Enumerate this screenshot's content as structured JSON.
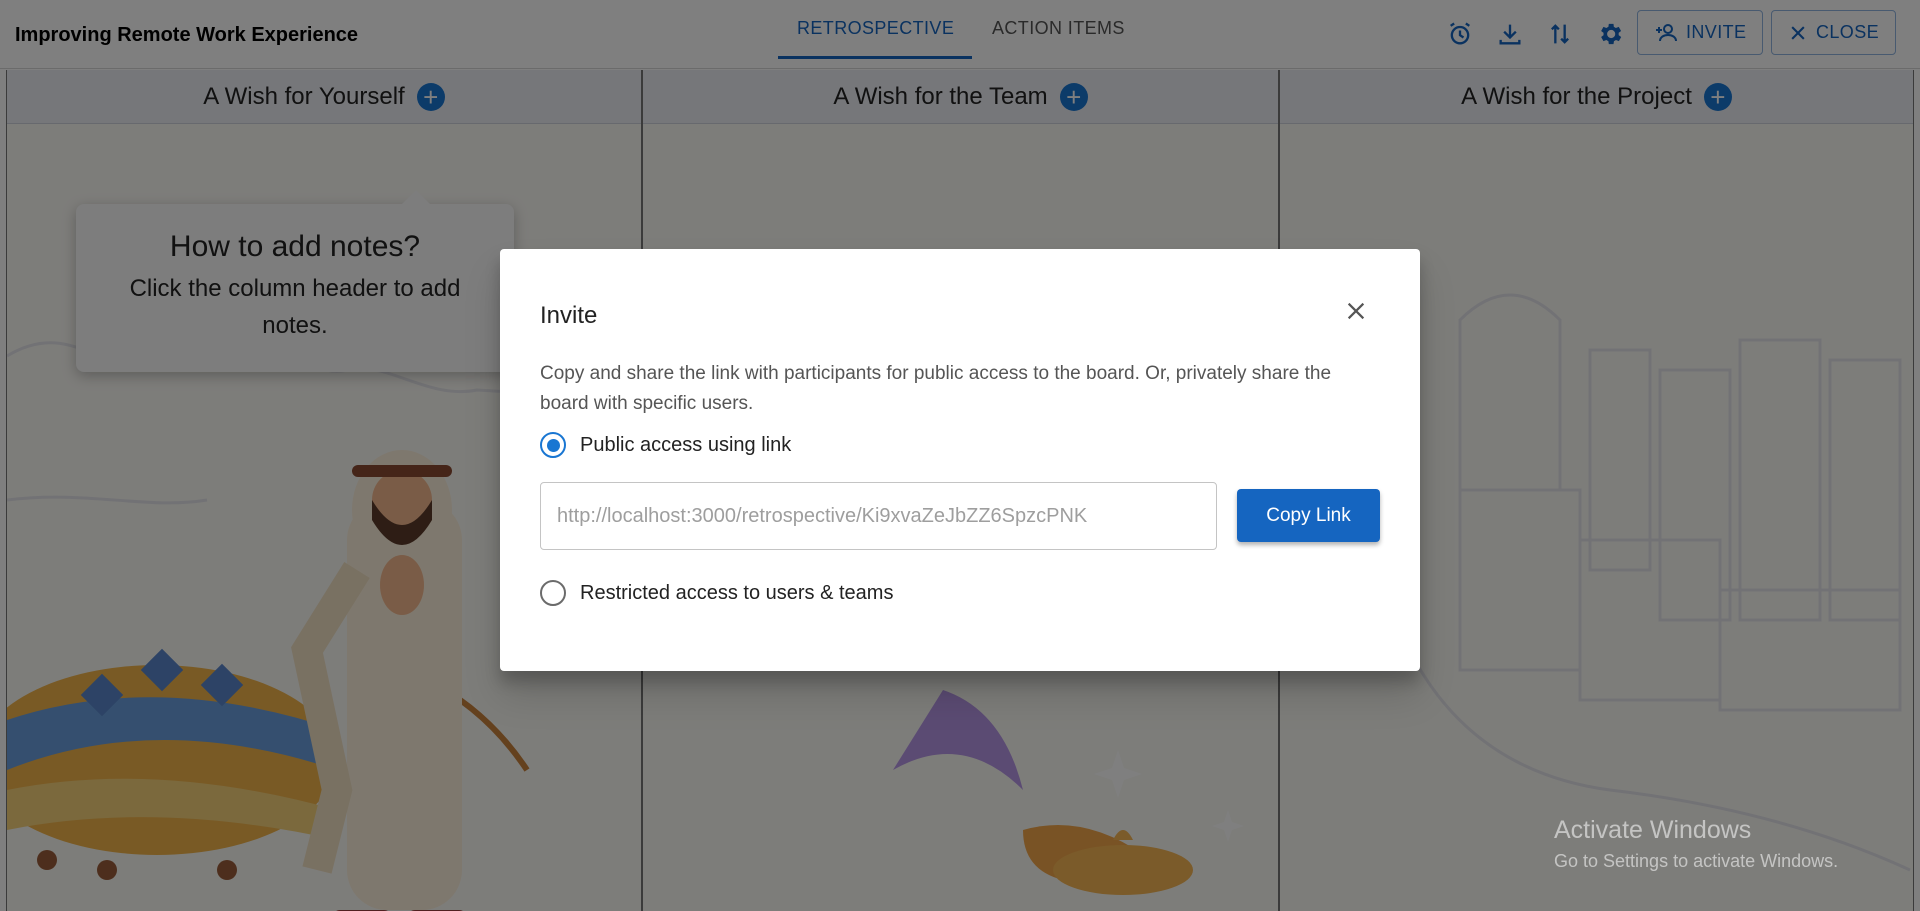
{
  "header": {
    "board_title": "Improving Remote Work Experience",
    "tabs": [
      {
        "label": "RETROSPECTIVE",
        "active": true
      },
      {
        "label": "ACTION ITEMS",
        "active": false
      }
    ],
    "icons": [
      "alarm-icon",
      "download-icon",
      "sort-arrows-icon",
      "gear-icon"
    ],
    "invite_label": "INVITE",
    "close_label": "CLOSE",
    "accent_color": "#1565c0"
  },
  "board": {
    "columns": [
      {
        "title": "A Wish for Yourself"
      },
      {
        "title": "A Wish for the Team"
      },
      {
        "title": "A Wish for the Project"
      }
    ],
    "add_icon": "plus-circle-icon",
    "tooltip": {
      "title": "How to add notes?",
      "body": "Click the column header to add notes."
    }
  },
  "dialog": {
    "title": "Invite",
    "description": "Copy and share the link with participants for public access to the board. Or, privately share the board with specific users.",
    "options": [
      {
        "label": "Public access using link",
        "selected": true
      },
      {
        "label": "Restricted access to users & teams",
        "selected": false
      }
    ],
    "link_value": "http://localhost:3000/retrospective/Ki9xvaZeJbZZ6SpzcPNK",
    "copy_label": "Copy Link"
  },
  "watermark": {
    "title": "Activate Windows",
    "subtitle": "Go to Settings to activate Windows."
  }
}
